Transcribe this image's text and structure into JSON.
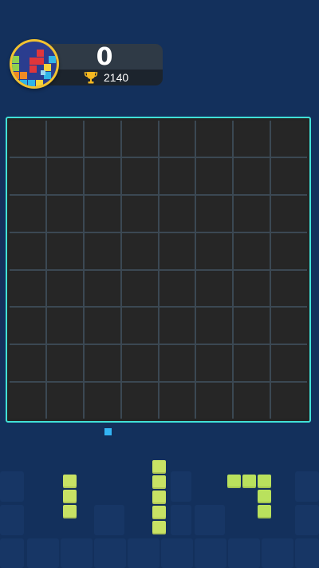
{
  "header": {
    "score": "0",
    "best_score": "2140",
    "trophy_icon": "trophy-icon",
    "logo_icon": "block-puzzle-logo-icon"
  },
  "board": {
    "rows": 8,
    "cols": 8,
    "border_color": "#41e0d6",
    "cell_color": "#262626"
  },
  "pieces": [
    {
      "name": "vertical-3",
      "color": "#c8e264"
    },
    {
      "name": "vertical-5",
      "color": "#c8e264"
    },
    {
      "name": "corner-5",
      "color": "#b9e15d"
    }
  ],
  "colors": {
    "background": "#13305c",
    "cursor": "#33b5f5"
  }
}
